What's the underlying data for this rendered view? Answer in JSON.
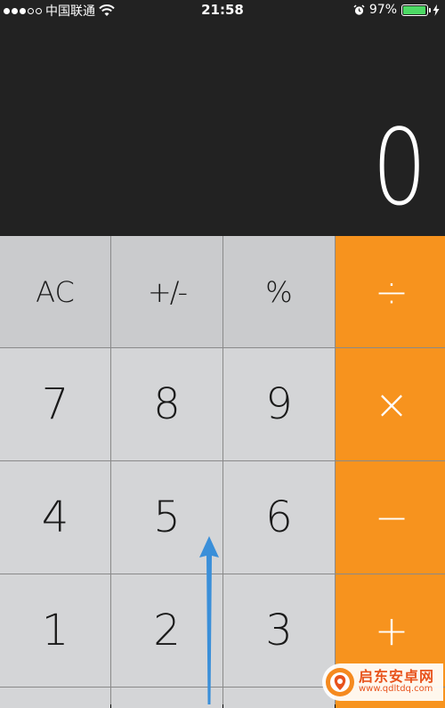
{
  "status_bar": {
    "signal_dots": [
      true,
      true,
      true,
      false,
      false
    ],
    "carrier": "中国联通",
    "time": "21:58",
    "battery_percent_text": "97%",
    "battery_level": 0.97,
    "icons": [
      "signal-icon",
      "wifi-icon",
      "alarm-icon",
      "battery-icon",
      "charging-icon"
    ]
  },
  "display": {
    "value": "0"
  },
  "keys": {
    "row1": [
      "AC",
      "+/-",
      "%",
      "÷"
    ],
    "row2": [
      "7",
      "8",
      "9",
      "×"
    ],
    "row3": [
      "4",
      "5",
      "6",
      "−"
    ],
    "row4": [
      "1",
      "2",
      "3",
      "+"
    ]
  },
  "colors": {
    "display_bg": "#222222",
    "function_key": "#cacbcd",
    "number_key": "#d4d5d7",
    "operator_key": "#f7931e",
    "battery_green": "#4cd964",
    "arrow_blue": "#3a8fd9"
  },
  "watermark": {
    "title": "启东安卓网",
    "url": "www.qdltdq.com"
  }
}
